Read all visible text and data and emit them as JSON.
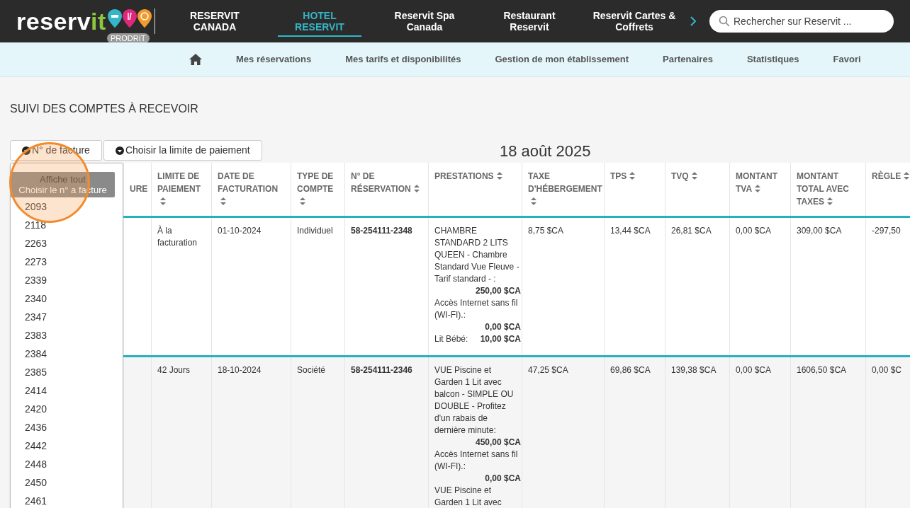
{
  "top_bar": {
    "logo": {
      "main": "reserv",
      "accent": "it"
    },
    "badge": "PRODRIT",
    "tabs": [
      {
        "label": "RESERVIT CANADA",
        "selected": false
      },
      {
        "label": "HOTEL RESERVIT",
        "selected": true
      },
      {
        "label": "Reservit Spa Canada",
        "selected": false
      },
      {
        "label": "Restaurant Reservit",
        "selected": false
      },
      {
        "label": "Reservit Cartes & Coffrets",
        "selected": false
      }
    ],
    "search": {
      "placeholder": "Rechercher sur Reservit ..."
    }
  },
  "sub_nav": {
    "items": [
      "Mes réservations",
      "Mes tarifs et disponibilités",
      "Gestion de mon établissement",
      "Partenaires",
      "Statistiques",
      "Favori"
    ]
  },
  "page_title": "SUIVI DES COMPTES À RECEVOIR",
  "filters": [
    {
      "label": "N° de facture"
    },
    {
      "label": "Choisir la limite de paiement"
    }
  ],
  "date": "18 août 2025",
  "invoice_dropdown": {
    "show_all": "Affiche tout",
    "prompt": "Choisir le n° a facture",
    "options": [
      "2093",
      "2118",
      "2263",
      "2273",
      "2339",
      "2340",
      "2347",
      "2383",
      "2384",
      "2385",
      "2414",
      "2420",
      "2436",
      "2442",
      "2448",
      "2450",
      "2461"
    ]
  },
  "table": {
    "columns": [
      {
        "label": "URE",
        "sortable": false
      },
      {
        "label": "LIMITE DE PAIEMENT",
        "sortable": true
      },
      {
        "label": "DATE DE FACTURATION",
        "sortable": true
      },
      {
        "label": "TYPE DE COMPTE",
        "sortable": true
      },
      {
        "label": "N° DE RÉSERVATION",
        "sortable": true
      },
      {
        "label": "PRESTATIONS",
        "sortable": true
      },
      {
        "label": "TAXE D'HÉBERGEMENT",
        "sortable": true
      },
      {
        "label": "TPS",
        "sortable": true
      },
      {
        "label": "TVQ",
        "sortable": true
      },
      {
        "label": "MONTANT TVA",
        "sortable": true
      },
      {
        "label": "MONTANT TOTAL AVEC TAXES",
        "sortable": true
      },
      {
        "label": "RÈGLE",
        "sortable": true
      }
    ],
    "rows": [
      {
        "limit": "À la facturation",
        "date": "01-10-2024",
        "type": "Individuel",
        "reservation": "58-254111-2348",
        "services": [
          {
            "kind": "block",
            "label": "CHAMBRE STANDARD 2 LITS QUEEN - Chambre Standard Vue Fleuve - Tarif standard - :",
            "amount": "250,00 $CA"
          },
          {
            "kind": "block",
            "label": "Accès Internet sans fil (WI-FI).:",
            "amount": "0,00 $CA"
          },
          {
            "kind": "inline",
            "label": "Lit Bébé:",
            "amount": "10,00 $CA"
          }
        ],
        "lodging_tax": "8,75 $CA",
        "tps": "13,44 $CA",
        "tvq": "26,81 $CA",
        "vat": "0,00 $CA",
        "total": "309,00 $CA",
        "settlement": "-297,50"
      },
      {
        "limit": "42 Jours",
        "date": "18-10-2024",
        "type": "Société",
        "reservation": "58-254111-2346",
        "services": [
          {
            "kind": "block",
            "label": "VUE Piscine et Garden 1 Lit avec balcon - SIMPLE OU DOUBLE - Profitez d'un rabais de dernière minute:",
            "amount": "450,00 $CA"
          },
          {
            "kind": "block",
            "label": "Accès Internet sans fil (WI-FI).:",
            "amount": "0,00 $CA"
          },
          {
            "kind": "block",
            "label": "VUE Piscine et Garden 1 Lit avec"
          }
        ],
        "lodging_tax": "47,25 $CA",
        "tps": "69,86 $CA",
        "tvq": "139,38 $CA",
        "vat": "0,00 $CA",
        "total": "1606,50 $CA",
        "settlement": "0,00 $C"
      }
    ]
  }
}
